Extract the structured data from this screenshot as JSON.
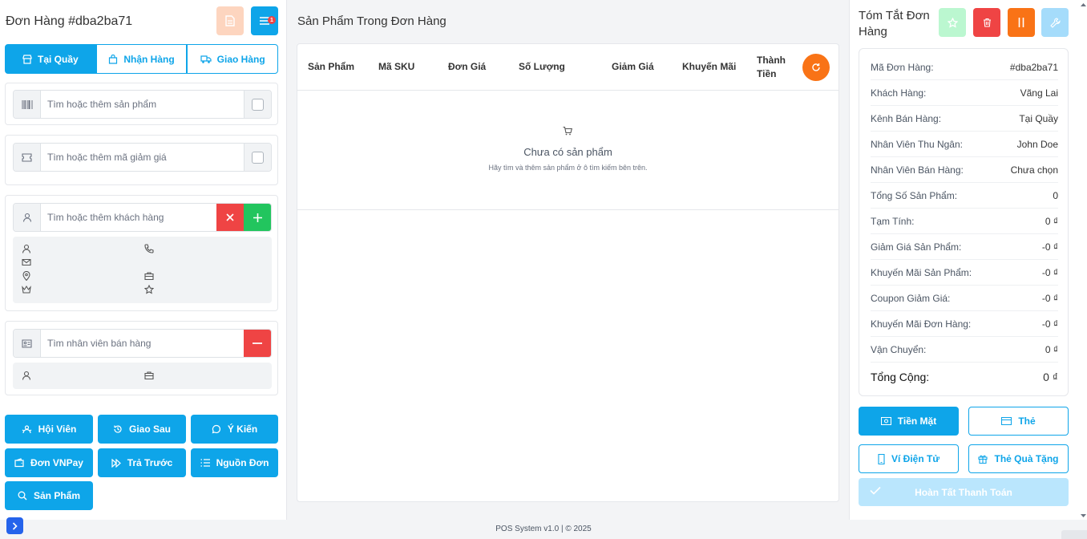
{
  "left": {
    "title": "Đơn Hàng #dba2ba71",
    "list_badge": "1",
    "tabs": [
      {
        "label": "Tại Quầy",
        "active": true,
        "icon": "store-icon"
      },
      {
        "label": "Nhận Hàng",
        "active": false,
        "icon": "shopping-bag-icon"
      },
      {
        "label": "Giao Hàng",
        "active": false,
        "icon": "truck-icon"
      }
    ],
    "product_search": {
      "placeholder": "Tìm hoặc thêm sản phẩm",
      "icon": "barcode-icon"
    },
    "coupon_search": {
      "placeholder": "Tìm hoặc thêm mã giảm giá",
      "icon": "ticket-icon"
    },
    "customer_search": {
      "placeholder": "Tìm hoặc thêm khách hàng",
      "icon": "user-icon"
    },
    "staff_search": {
      "placeholder": "Tìm nhân viên bán hàng",
      "icon": "id-card-icon"
    },
    "quick_actions": [
      {
        "label": "Hội Viên",
        "icon": "members-icon"
      },
      {
        "label": "Giao Sau",
        "icon": "history-icon"
      },
      {
        "label": "Ý Kiến",
        "icon": "chat-icon"
      },
      {
        "label": "Đơn VNPay",
        "icon": "wallet-icon"
      },
      {
        "label": "Trả Trước",
        "icon": "fast-forward-icon"
      },
      {
        "label": "Nguồn Đơn",
        "icon": "list-icon"
      },
      {
        "label": "Sản Phẩm",
        "icon": "search-icon"
      }
    ]
  },
  "middle": {
    "title": "Sản Phẩm Trong Đơn Hàng",
    "columns": [
      "Sản Phẩm",
      "Mã SKU",
      "Đơn Giá",
      "Số Lượng",
      "Giảm Giá",
      "Khuyến Mãi",
      "Thành Tiền"
    ],
    "empty_title": "Chưa có sản phẩm",
    "empty_subtitle": "Hãy tìm và thêm sản phẩm ở ô tìm kiếm bên trên."
  },
  "summary": {
    "title": "Tóm Tắt Đơn Hàng",
    "rows": [
      {
        "label": "Mã Đơn Hàng:",
        "value": "#dba2ba71"
      },
      {
        "label": "Khách Hàng:",
        "value": "Vãng Lai"
      },
      {
        "label": "Kênh Bán Hàng:",
        "value": "Tại Quầy"
      },
      {
        "label": "Nhân Viên Thu Ngân:",
        "value": "John Doe"
      },
      {
        "label": "Nhân Viên Bán Hàng:",
        "value": "Chưa chọn"
      },
      {
        "label": "Tổng Số Sản Phẩm:",
        "value": "0"
      },
      {
        "label": "Tạm Tính:",
        "value": "0 ₫"
      },
      {
        "label": "Giảm Giá Sản Phẩm:",
        "value": "-0 ₫"
      },
      {
        "label": "Khuyến Mãi Sản Phẩm:",
        "value": "-0 ₫"
      },
      {
        "label": "Coupon Giảm Giá:",
        "value": "-0 ₫"
      },
      {
        "label": "Khuyến Mãi Đơn Hàng:",
        "value": "-0 ₫"
      },
      {
        "label": "Vận Chuyển:",
        "value": "0 ₫"
      }
    ],
    "total": {
      "label": "Tổng Cộng:",
      "value": "0 ₫"
    }
  },
  "payment": {
    "methods": [
      {
        "label": "Tiền Mặt",
        "icon": "cash-icon"
      },
      {
        "label": "Thẻ",
        "icon": "credit-card-icon"
      },
      {
        "label": "Ví Điện Tử",
        "icon": "mobile-wallet-icon"
      },
      {
        "label": "Thẻ Quà Tặng",
        "icon": "gift-icon"
      }
    ],
    "complete_label": "Hoàn Tất Thanh Toán"
  },
  "footer": {
    "text": "POS System v1.0 | © 2025"
  },
  "colors": {
    "primary": "#0ea5e9",
    "danger": "#ef4444",
    "success": "#22c55e",
    "warning": "#f97316"
  }
}
